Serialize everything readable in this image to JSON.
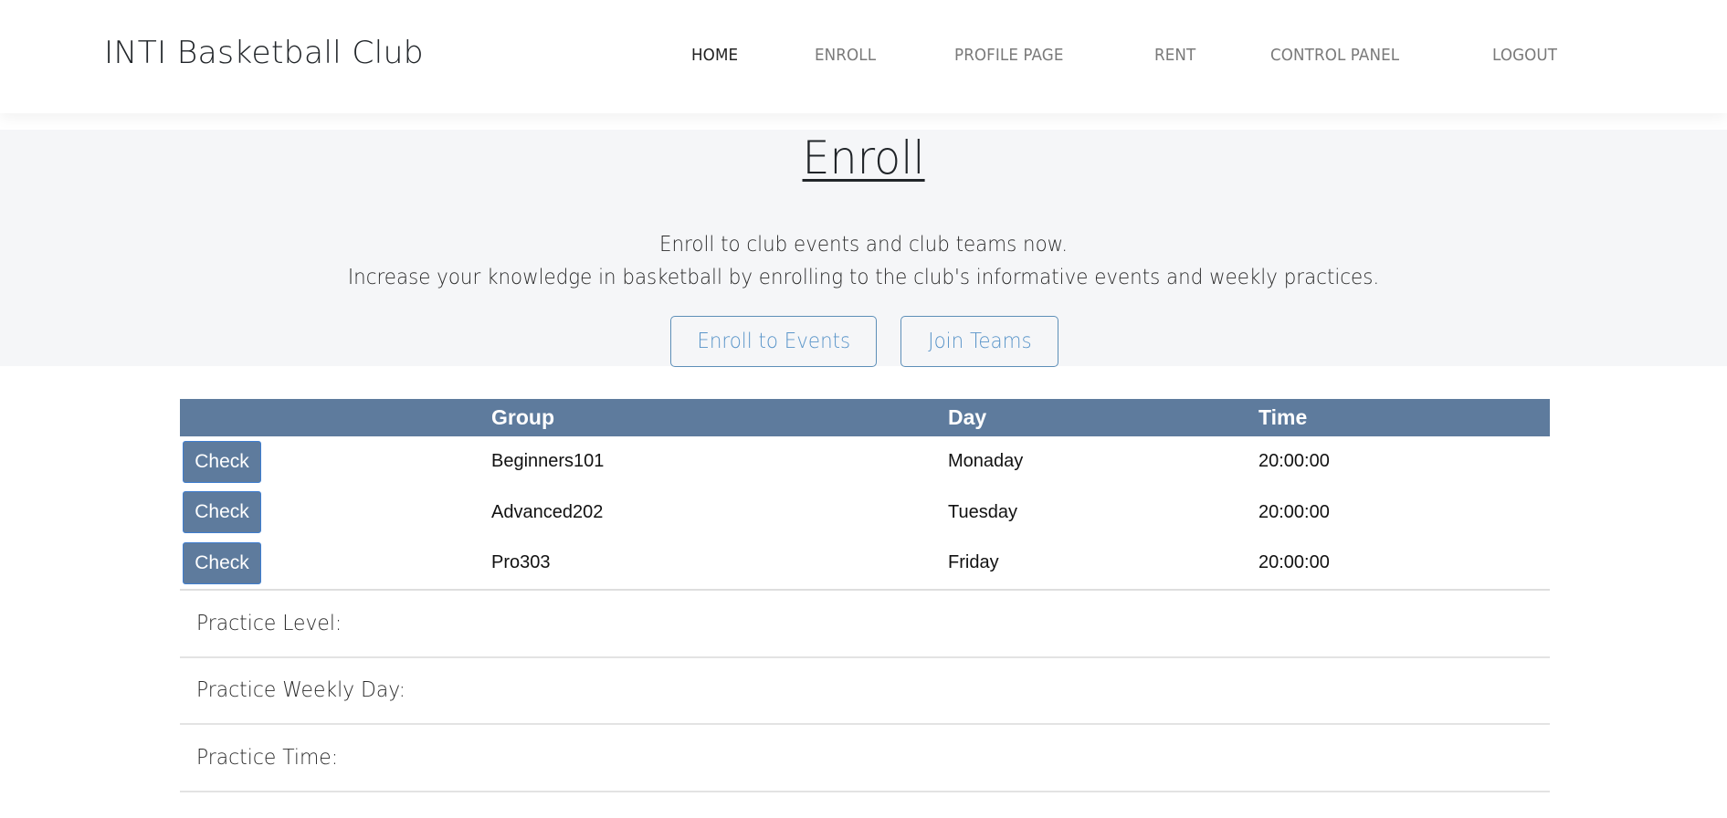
{
  "navbar": {
    "brand": "INTI Basketball Club",
    "links": [
      {
        "label": "HOME",
        "active": true
      },
      {
        "label": "ENROLL",
        "active": false
      },
      {
        "label": "PROFILE PAGE",
        "active": false
      },
      {
        "label": "RENT",
        "active": false
      },
      {
        "label": "CONTROL PANEL",
        "active": false
      },
      {
        "label": "LOGOUT",
        "active": false
      }
    ]
  },
  "hero": {
    "title": "Enroll",
    "lead_line1": "Enroll to club events and club teams now.",
    "lead_line2": "Increase your knowledge in basketball by enrolling to the club's informative events and weekly practices.",
    "buttons": {
      "enroll_events": "Enroll to Events",
      "join_teams": "Join Teams"
    }
  },
  "groups_table": {
    "columns": [
      "",
      "Group",
      "Day",
      "Time"
    ],
    "rows": [
      {
        "action": "Check",
        "group": "Beginners101",
        "day": "Monaday",
        "time": "20:00:00"
      },
      {
        "action": "Check",
        "group": "Advanced202",
        "day": "Tuesday",
        "time": "20:00:00"
      },
      {
        "action": "Check",
        "group": "Pro303",
        "day": "Friday",
        "time": "20:00:00"
      }
    ]
  },
  "practice_details": [
    {
      "label": "Practice Level:",
      "value": ""
    },
    {
      "label": "Practice Weekly Day:",
      "value": ""
    },
    {
      "label": "Practice Time:",
      "value": ""
    }
  ],
  "colors": {
    "table_header_bg": "#5e7b9d",
    "outline_button": "#5a95c9",
    "hero_bg": "#f5f6f8",
    "nav_active": "#222222",
    "nav_inactive": "#7a7a7a"
  }
}
